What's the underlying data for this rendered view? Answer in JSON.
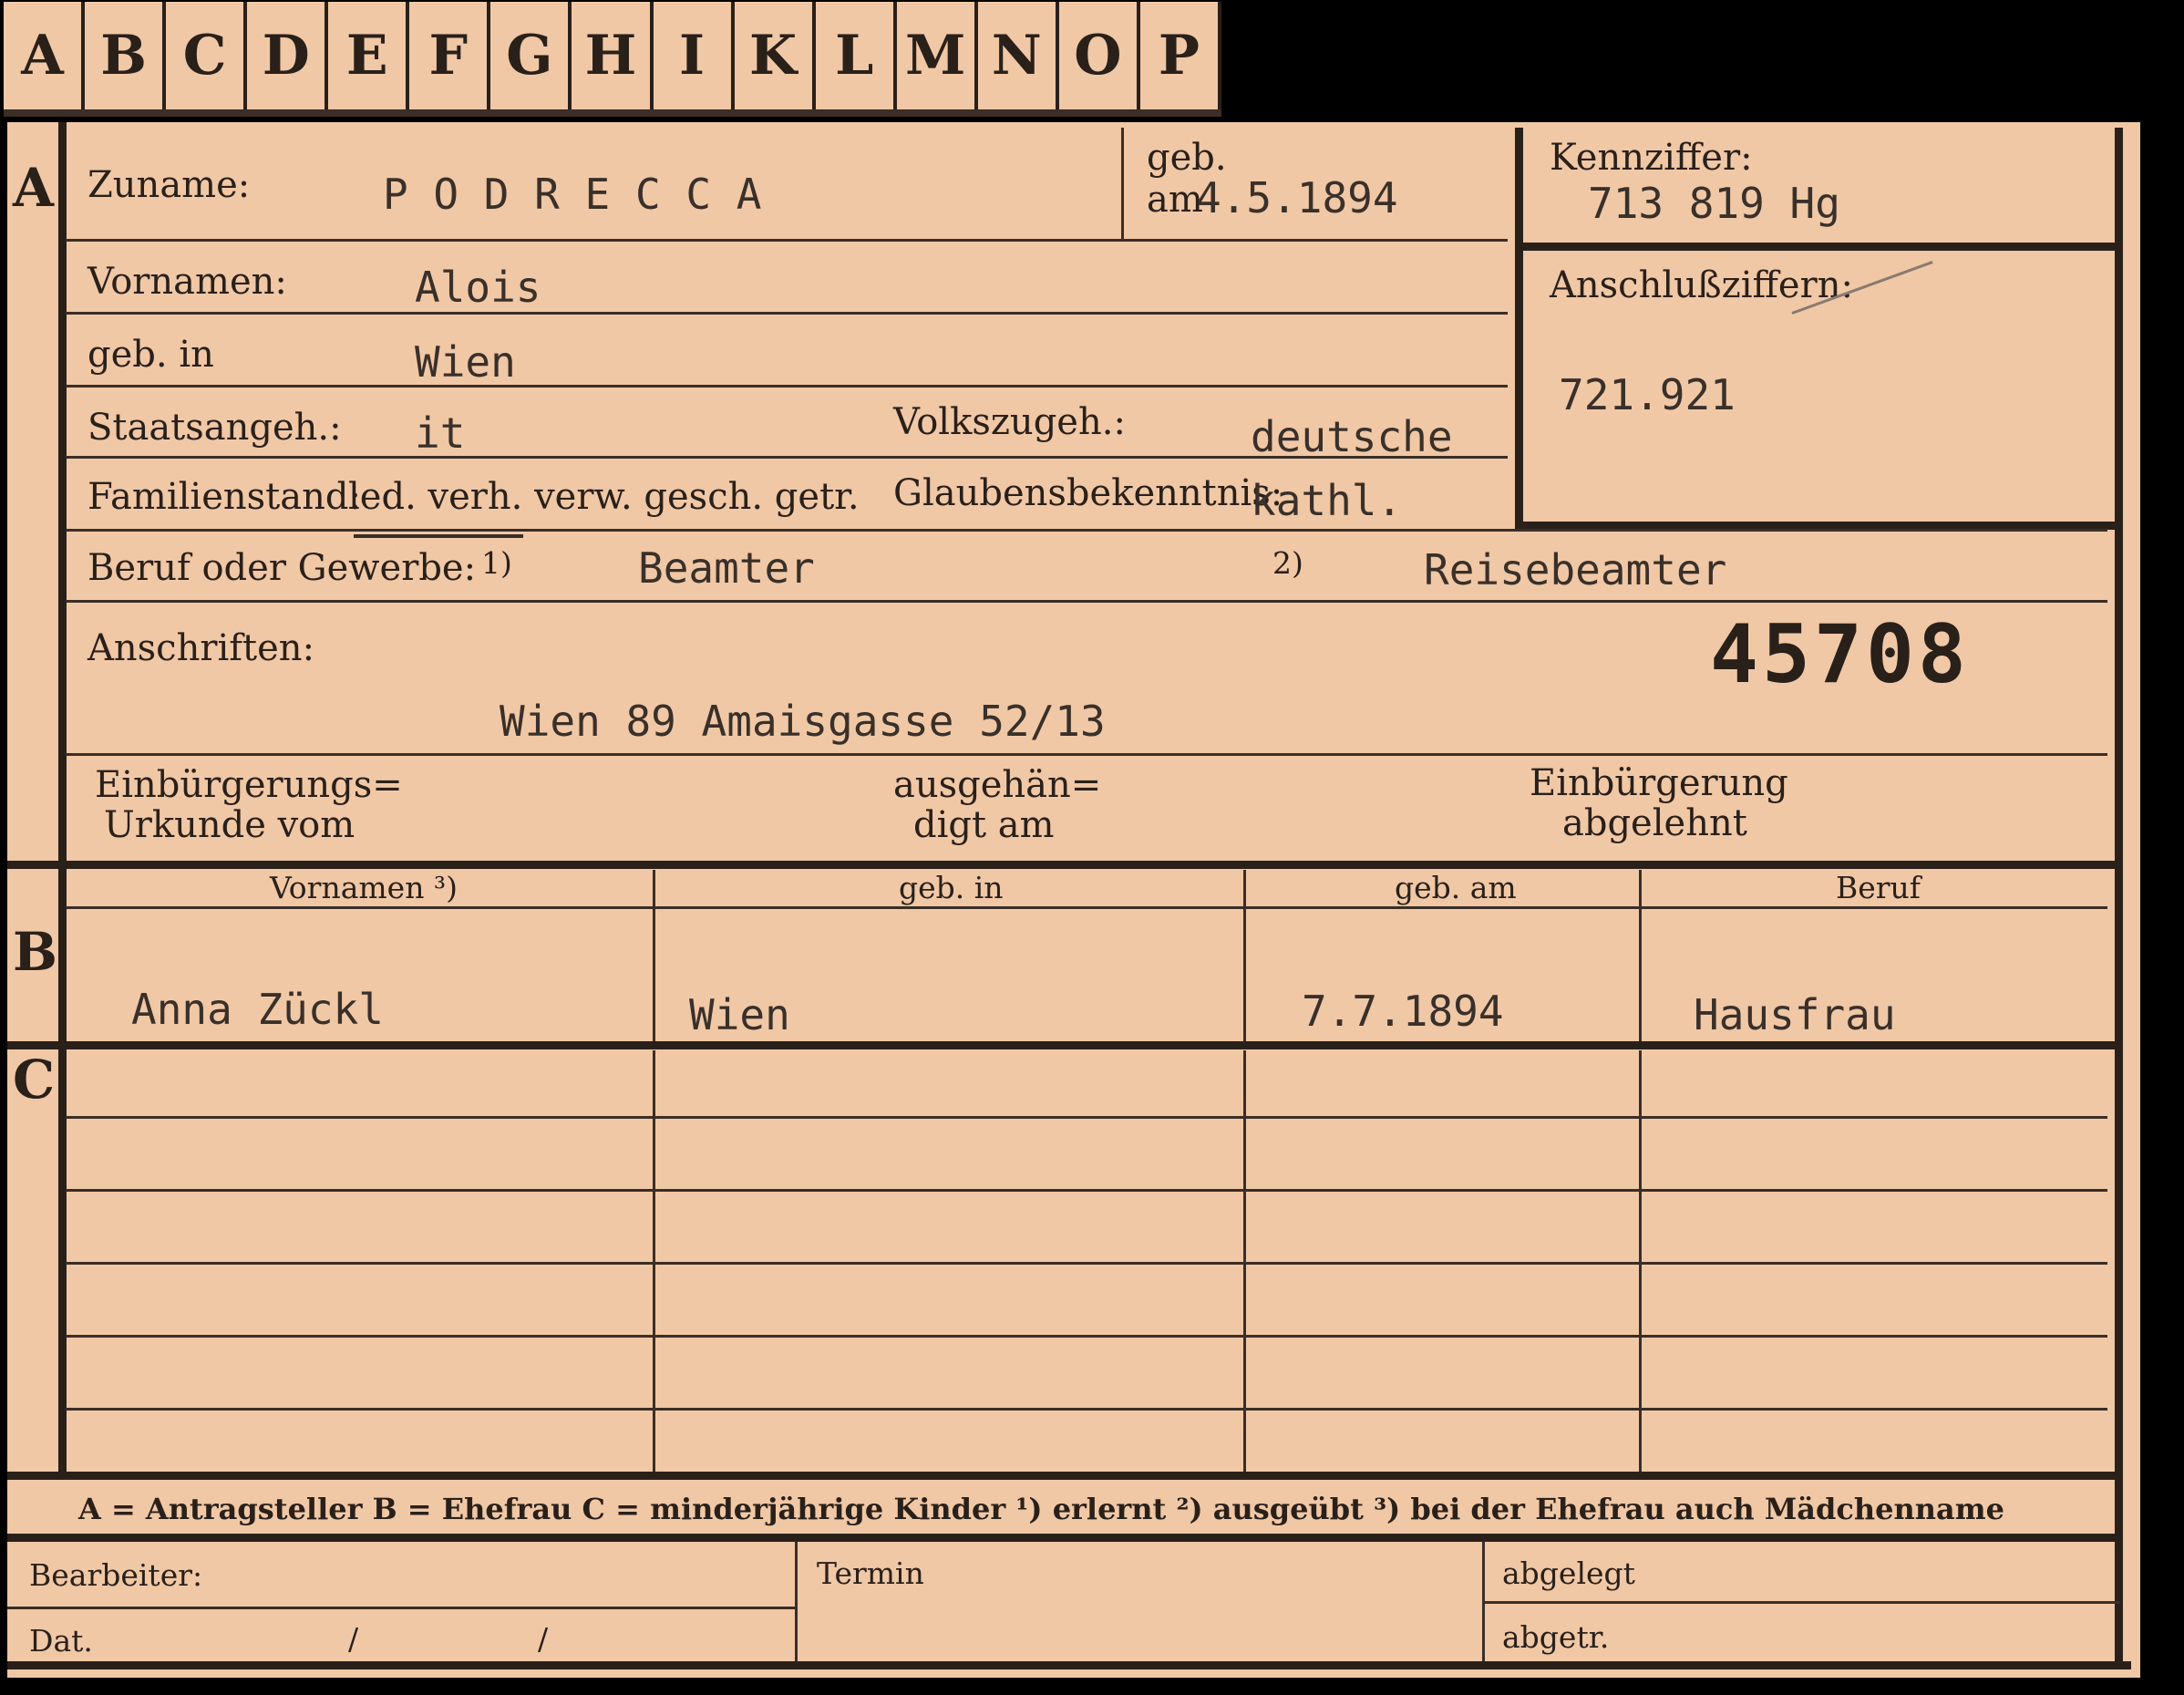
{
  "tabs": [
    "A",
    "B",
    "C",
    "D",
    "E",
    "F",
    "G",
    "H",
    "I",
    "K",
    "L",
    "M",
    "N",
    "O",
    "P"
  ],
  "sections": {
    "a": "A",
    "b": "B",
    "c": "C"
  },
  "a": {
    "zuname_label": "Zuname:",
    "zuname_value": "P O D R E C C A",
    "geb_label": "geb.",
    "geb_am_label": "am",
    "geb_am_value": "4.5.1894",
    "vornamen_label": "Vornamen:",
    "vornamen_value": "Alois",
    "gebin_label": "geb. in",
    "gebin_value": "Wien",
    "staat_label": "Staatsangeh.:",
    "staat_value": "it",
    "volk_label": "Volkszugeh.:",
    "volk_value": "deutsche",
    "familien_label": "Familienstand:",
    "familien_options": "led. verh. verw. gesch. getr.",
    "glauben_label": "Glaubensbekenntnis:",
    "glauben_value": "kathl.",
    "beruf_label": "Beruf oder Gewerbe:",
    "beruf_mark1": "1)",
    "beruf_value1": "Beamter",
    "beruf_mark2": "2)",
    "beruf_value2": "Reisebeamter",
    "anschriften_label": "Anschriften:",
    "anschrift_value": "Wien 89 Amaisgasse 52/13",
    "number": "45708",
    "einb_label1": "Einbürgerungs=",
    "einb_label2": "Urkunde vom",
    "ausg_label1": "ausgehän=",
    "ausg_label2": "digt am",
    "abgel_label1": "Einbürgerung",
    "abgel_label2": "abgelehnt",
    "kenn_label": "Kennziffer:",
    "kenn_value": "713 819  Hg",
    "ansch_label": "Anschlußziffern:",
    "ansch_value": "721.921"
  },
  "b": {
    "headers": [
      "Vornamen ³)",
      "geb. in",
      "geb. am",
      "Beruf"
    ],
    "row": {
      "vornamen": "Anna  Zückl",
      "gebin": "Wien",
      "gebam": "7.7.1894",
      "beruf": "Hausfrau"
    }
  },
  "footer": {
    "legend": "A = Antragsteller   B = Ehefrau   C = minderjährige Kinder   ¹) erlernt   ²) ausgeübt   ³) bei der Ehefrau auch Mädchenname",
    "bearbeiter": "Bearbeiter:",
    "dat": "Dat.",
    "slash": "/",
    "termin": "Termin",
    "abgelegt": "abgelegt",
    "abgetr": "abgetr."
  }
}
